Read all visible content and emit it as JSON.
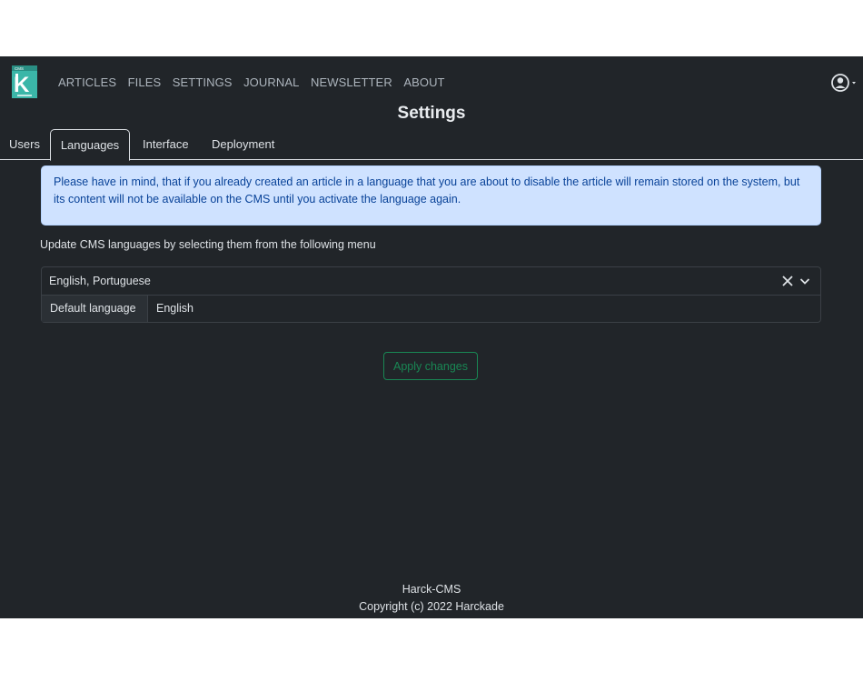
{
  "navbar": {
    "logo_icon": "harck-cms-logo-icon",
    "links": [
      "ARTICLES",
      "FILES",
      "SETTINGS",
      "JOURNAL",
      "NEWSLETTER",
      "ABOUT"
    ],
    "user_icon": "user-circle-icon"
  },
  "page": {
    "title": "Settings"
  },
  "tabs": [
    {
      "label": "Users"
    },
    {
      "label": "Languages",
      "active": true
    },
    {
      "label": "Interface"
    },
    {
      "label": "Deployment"
    }
  ],
  "alert": {
    "text": "Please have in mind, that if you already created an article in a language that you are about to disable the article will remain stored on the system, but its content will not be available on the CMS until you activate the language again."
  },
  "languages": {
    "instruction": "Update CMS languages by selecting them from the following menu",
    "selected": "English, Portuguese",
    "default_label": "Default language",
    "default_value": "English"
  },
  "actions": {
    "apply_label": "Apply changes"
  },
  "footer": {
    "line1": "Harck-CMS",
    "line2": "Copyright (c) 2022 Harckade"
  },
  "colors": {
    "background": "#212529",
    "alert_bg": "#cfe2ff",
    "alert_text": "#084298",
    "success": "#198754",
    "logo_teal": "#3bb6a8"
  }
}
